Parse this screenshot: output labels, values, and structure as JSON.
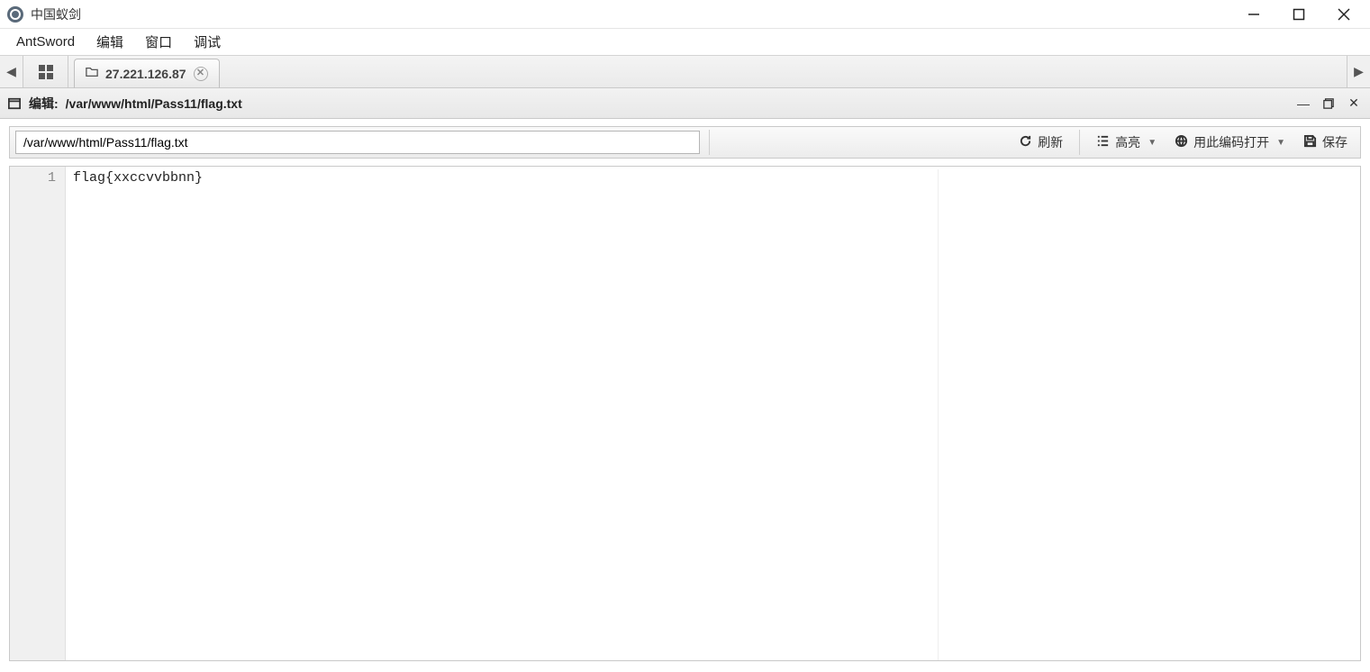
{
  "window": {
    "title": "中国蚁剑"
  },
  "menubar": {
    "appname": "AntSword",
    "items": [
      "编辑",
      "窗口",
      "调试"
    ]
  },
  "tabs": {
    "active": {
      "label": "27.221.126.87"
    }
  },
  "panel": {
    "title_prefix": "编辑:",
    "title_path": "/var/www/html/Pass11/flag.txt"
  },
  "toolbar": {
    "path_value": "/var/www/html/Pass11/flag.txt",
    "refresh_label": "刷新",
    "highlight_label": "高亮",
    "encoding_label": "用此编码打开",
    "save_label": "保存"
  },
  "editor": {
    "line_numbers": [
      "1"
    ],
    "lines": [
      "flag{xxccvvbbnn}"
    ]
  }
}
